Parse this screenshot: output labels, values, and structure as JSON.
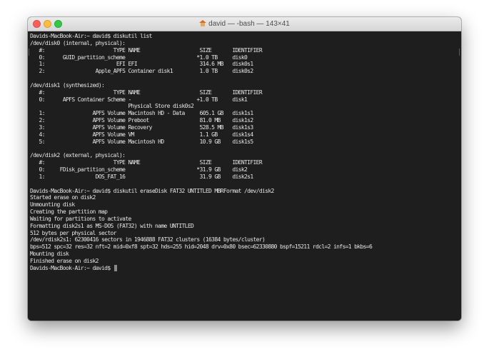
{
  "window": {
    "title": "david — -bash — 143×41",
    "home_icon": "house-icon"
  },
  "terminal": {
    "lines": [
      "Davids-MacBook-Air:~ david$ diskutil list",
      "/dev/disk0 (internal, physical):",
      "   #:                       TYPE NAME                    SIZE       IDENTIFIER",
      "   0:      GUID_partition_scheme                        *1.0 TB     disk0",
      "   1:                        EFI EFI                     314.6 MB   disk0s1",
      "   2:                 Apple_APFS Container disk1         1.0 TB     disk0s2",
      "",
      "/dev/disk1 (synthesized):",
      "   #:                       TYPE NAME                    SIZE       IDENTIFIER",
      "   0:      APFS Container Scheme -                      +1.0 TB     disk1",
      "                                 Physical Store disk0s2",
      "   1:                APFS Volume Macintosh HD - Data     605.1 GB   disk1s1",
      "   2:                APFS Volume Preboot                 81.0 MB    disk1s2",
      "   3:                APFS Volume Recovery                528.5 MB   disk1s3",
      "   4:                APFS Volume VM                      1.1 GB     disk1s4",
      "   5:                APFS Volume Macintosh HD            10.9 GB    disk1s5",
      "",
      "/dev/disk2 (external, physical):",
      "   #:                       TYPE NAME                    SIZE       IDENTIFIER",
      "   0:     FDisk_partition_scheme                        *31.9 GB    disk2",
      "   1:                 DOS_FAT_16                         31.9 GB    disk2s1",
      "",
      "Davids-MacBook-Air:~ david$ diskutil eraseDisk FAT32 UNTITLED MBRFormat /dev/disk2",
      "Started erase on disk2",
      "Unmounting disk",
      "Creating the partition map",
      "Waiting for partitions to activate",
      "Formatting disk2s1 as MS-DOS (FAT32) with name UNTITLED",
      "512 bytes per physical sector",
      "/dev/rdisk2s1: 62300416 sectors in 1946888 FAT32 clusters (16384 bytes/cluster)",
      "bps=512 spc=32 res=32 nft=2 mid=0xf8 spt=32 hds=255 hid=2048 drv=0x80 bsec=62330880 bspf=15211 rdcl=2 infs=1 bkbs=6",
      "Mounting disk",
      "Finished erase on disk2"
    ],
    "prompt": "Davids-MacBook-Air:~ david$ "
  },
  "colors": {
    "terminal_bg": "#1e1e1e",
    "terminal_fg": "#e6e6e6",
    "close": "#fc605c",
    "minimize": "#fdbc40",
    "zoom": "#34c84a"
  }
}
